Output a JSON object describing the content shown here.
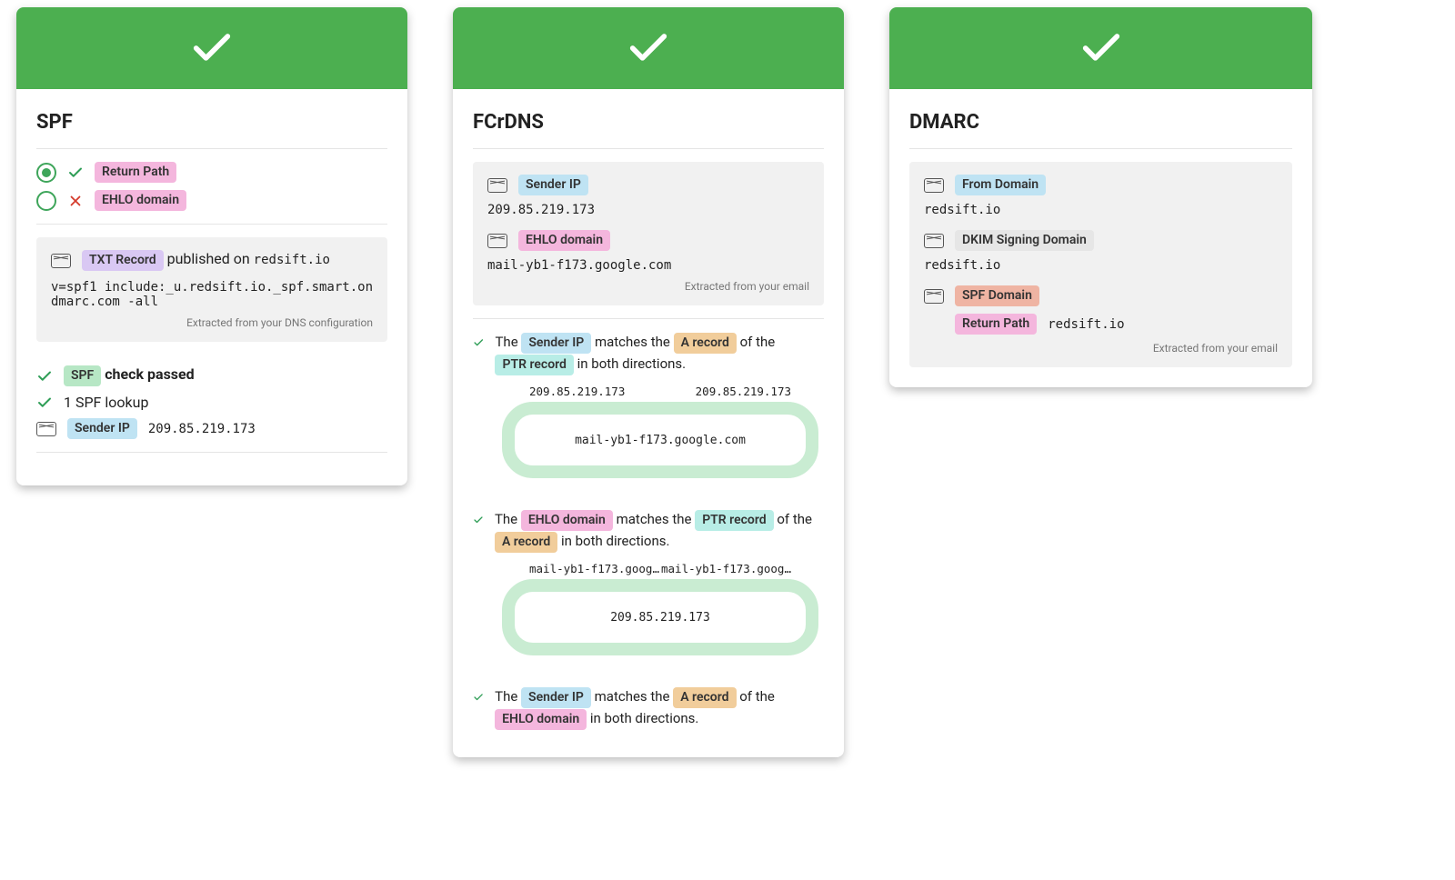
{
  "spf": {
    "title": "SPF",
    "option1": "Return Path",
    "option2": "EHLO domain",
    "txt_label": "TXT Record",
    "published_on_prefix": " published on ",
    "published_on_domain": "redsift.io",
    "txt_value": "v=spf1 include:_u.redsift.io._spf.smart.ondmarc.com -all",
    "extracted_note": "Extracted from your DNS configuration",
    "check_label": "SPF",
    "check_suffix": " check passed",
    "lookup_text": "1 SPF lookup",
    "sender_ip_label": "Sender IP",
    "sender_ip": "209.85.219.173"
  },
  "fcrdns": {
    "title": "FCrDNS",
    "sender_ip_label": "Sender IP",
    "sender_ip": "209.85.219.173",
    "ehlo_label": "EHLO domain",
    "ehlo_value": "mail-yb1-f173.google.com",
    "extracted_note": "Extracted from your email",
    "r1_pre": "The ",
    "r1_a": "Sender IP",
    "r1_mid1": " matches the ",
    "r1_b": "A record",
    "r1_mid2": " of the ",
    "r1_c": "PTR record",
    "r1_post": " in both directions.",
    "track1_left": "209.85.219.173",
    "track1_right": "209.85.219.173",
    "track1_center": "mail-yb1-f173.google.com",
    "r2_pre": "The ",
    "r2_a": "EHLO domain",
    "r2_mid1": " matches the ",
    "r2_b": "PTR record",
    "r2_mid2": " of the ",
    "r2_c": "A record",
    "r2_post": " in both directions.",
    "track2_left": "mail-yb1-f173.goog…",
    "track2_right": "mail-yb1-f173.goog…",
    "track2_center": "209.85.219.173",
    "r3_pre": "The ",
    "r3_a": "Sender IP",
    "r3_mid1": " matches the ",
    "r3_b": "A record",
    "r3_mid2": " of the ",
    "r3_c": "EHLO domain",
    "r3_post": " in both directions."
  },
  "dmarc": {
    "title": "DMARC",
    "from_label": "From Domain",
    "from_value": "redsift.io",
    "dkim_label": "DKIM Signing Domain",
    "dkim_value": "redsift.io",
    "spf_domain_label": "SPF Domain",
    "return_path_label": "Return Path",
    "return_path_value": "redsift.io",
    "extracted_note": "Extracted from your email"
  }
}
